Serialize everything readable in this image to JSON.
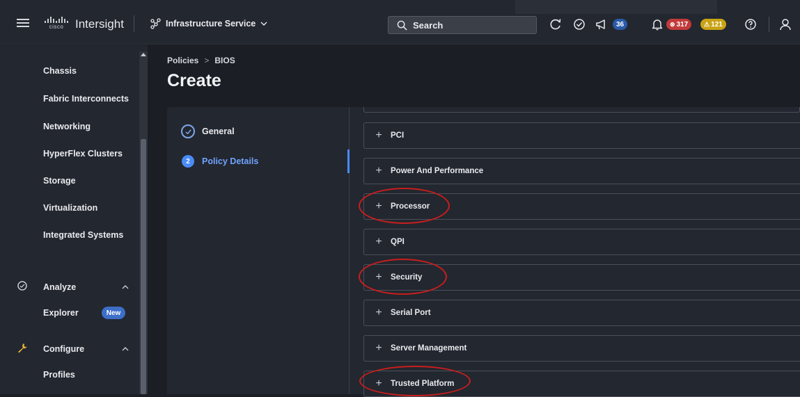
{
  "topbar": {
    "cisco_word": "cisco",
    "brand": "Intersight",
    "service": "Infrastructure Service",
    "search_label": "Search",
    "announcements_count": "36",
    "alarms_critical": "317",
    "alarms_warning": "121",
    "icons": [
      "menu-icon",
      "cisco-logo",
      "service-icon",
      "chevron-down-icon",
      "search-icon",
      "refresh-icon",
      "tasks-check-icon",
      "megaphone-icon",
      "bell-icon",
      "critical-icon",
      "warning-icon",
      "help-icon",
      "user-icon"
    ]
  },
  "sidebar": {
    "items": [
      {
        "label": "Chassis"
      },
      {
        "label": "Fabric Interconnects"
      },
      {
        "label": "Networking"
      },
      {
        "label": "HyperFlex Clusters"
      },
      {
        "label": "Storage"
      },
      {
        "label": "Virtualization"
      },
      {
        "label": "Integrated Systems"
      }
    ],
    "analyze": {
      "label": "Analyze",
      "icon": "analyze-icon"
    },
    "explorer": {
      "label": "Explorer",
      "badge": "New"
    },
    "configure": {
      "label": "Configure",
      "icon": "wrench-icon"
    },
    "profiles": {
      "label": "Profiles"
    }
  },
  "main": {
    "breadcrumb": {
      "parent": "Policies",
      "separator": ">",
      "current": "BIOS"
    },
    "title": "Create",
    "steps": [
      {
        "label": "General",
        "state": "complete"
      },
      {
        "number": "2",
        "label": "Policy Details",
        "state": "active"
      }
    ],
    "sections": [
      {
        "label": "PCI"
      },
      {
        "label": "Power And Performance"
      },
      {
        "label": "Processor",
        "highlighted": true
      },
      {
        "label": "QPI"
      },
      {
        "label": "Security",
        "highlighted": true
      },
      {
        "label": "Serial Port"
      },
      {
        "label": "Server Management"
      },
      {
        "label": "Trusted Platform",
        "highlighted": true
      }
    ],
    "expand_symbol": "+"
  },
  "colors": {
    "accent": "#4a8cf7",
    "highlight_ring": "#c81e1e",
    "critical": "#c23a3a",
    "warning": "#c9a316"
  }
}
